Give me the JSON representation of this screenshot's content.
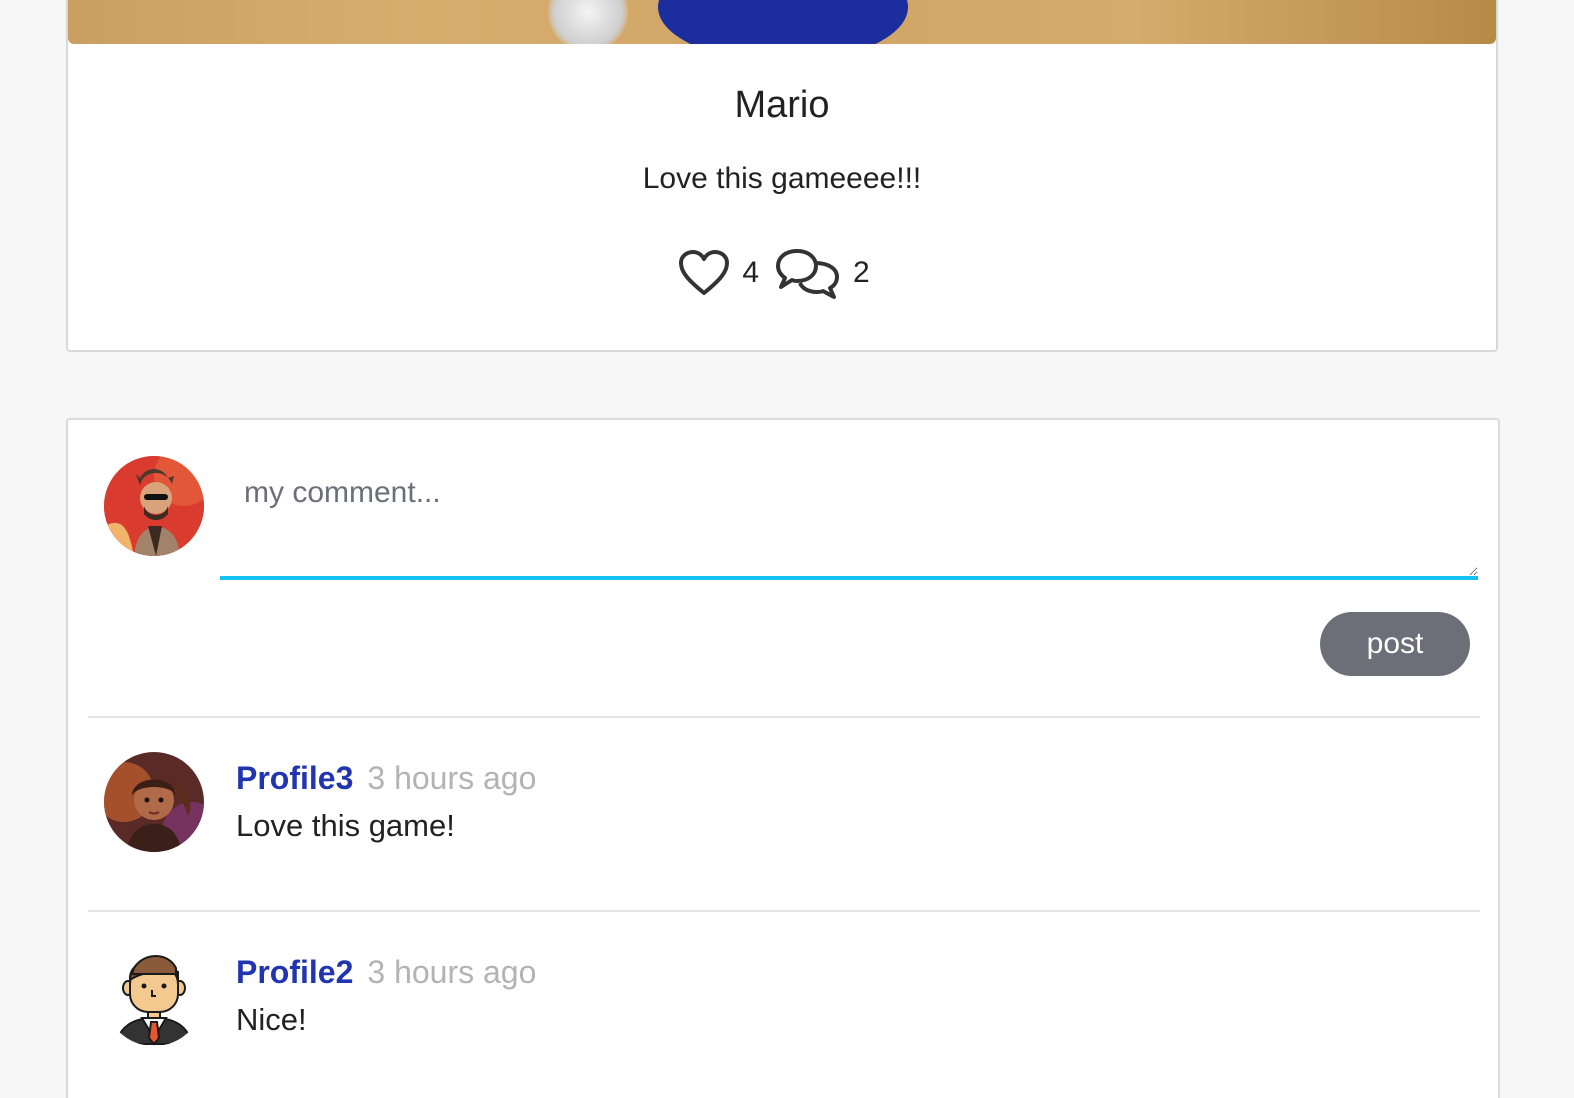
{
  "post": {
    "title": "Mario",
    "text": "Love this gameeee!!!",
    "likes": "4",
    "comments": "2",
    "like_icon": "heart-icon",
    "comment_icon": "speech-bubbles-icon"
  },
  "composer": {
    "placeholder": "my comment...",
    "post_label": "post",
    "accent_color": "#15c1f0"
  },
  "comments": [
    {
      "author": "Profile3",
      "time": "3 hours ago",
      "text": "Love this game!"
    },
    {
      "author": "Profile2",
      "time": "3 hours ago",
      "text": "Nice!"
    }
  ],
  "colors": {
    "author_link": "#2135b0",
    "timestamp": "#b3b3b3",
    "button_bg": "#6c6f78"
  }
}
